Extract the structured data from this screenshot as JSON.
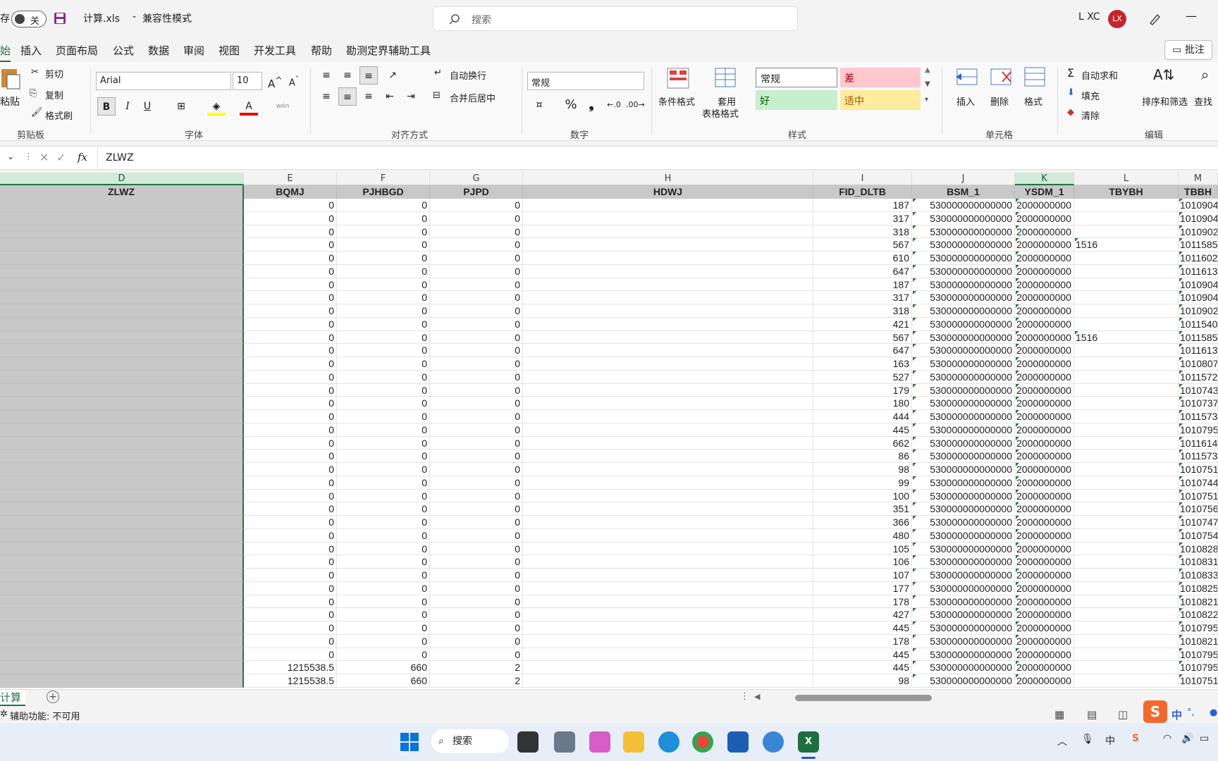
{
  "titlebar": {
    "autosave_label": "存",
    "autosave_state": "关",
    "filename": "计算.xls",
    "separator": "-",
    "mode": "兼容性模式",
    "search_placeholder": "搜索",
    "user_name": "L XC",
    "avatar_initials": "LX"
  },
  "menu": {
    "items": [
      "始",
      "插入",
      "页面布局",
      "公式",
      "数据",
      "审阅",
      "视图",
      "开发工具",
      "帮助",
      "勘测定界辅助工具"
    ],
    "comment_button": "批注"
  },
  "ribbon": {
    "clipboard": {
      "paste": "粘贴",
      "cut": "剪切",
      "copy": "复制",
      "format_painter": "格式刷",
      "group_label": "剪贴板"
    },
    "font": {
      "family": "Arial",
      "size": "10",
      "bold": "B",
      "italic": "I",
      "underline": "U",
      "wen": "wén",
      "group_label": "字体"
    },
    "alignment": {
      "wrap_text": "自动换行",
      "merge_center": "合并后居中",
      "group_label": "对齐方式"
    },
    "number": {
      "format": "常规",
      "percent": "%",
      "comma": "❟",
      "group_label": "数字"
    },
    "styles": {
      "conditional": "条件格式",
      "table_line1": "套用",
      "table_line2": "表格格式",
      "normal": "常规",
      "bad": "差",
      "good": "好",
      "neutral": "适中",
      "group_label": "样式"
    },
    "cells": {
      "insert": "插入",
      "delete": "删除",
      "format": "格式",
      "group_label": "单元格"
    },
    "editing": {
      "autosum": "自动求和",
      "fill": "填充",
      "clear": "清除",
      "sort_filter": "排序和筛选",
      "find": "查找",
      "group_label": "编辑"
    },
    "colors": {
      "bad_bg": "#ffc7ce",
      "bad_fg": "#9c0006",
      "good_bg": "#c6efce",
      "good_fg": "#006100",
      "neutral_bg": "#ffeb9c",
      "neutral_fg": "#9c5700"
    }
  },
  "formula_bar": {
    "content": "ZLWZ",
    "fx": "fx"
  },
  "grid": {
    "column_letters": [
      "D",
      "E",
      "F",
      "G",
      "H",
      "I",
      "J",
      "K",
      "L",
      "M"
    ],
    "headers": [
      "ZLWZ",
      "BQMJ",
      "PJHBGD",
      "PJPD",
      "HDWJ",
      "FID_DLTB",
      "BSM_1",
      "YSDM_1",
      "TBYBH",
      "TBBH"
    ],
    "rows": [
      [
        "",
        "0",
        "0",
        "0",
        "",
        "187",
        "530000000000000",
        "2000000000",
        "",
        "1010904"
      ],
      [
        "",
        "0",
        "0",
        "0",
        "",
        "317",
        "530000000000000",
        "2000000000",
        "",
        "1010904"
      ],
      [
        "",
        "0",
        "0",
        "0",
        "",
        "318",
        "530000000000000",
        "2000000000",
        "",
        "1010902"
      ],
      [
        "",
        "0",
        "0",
        "0",
        "",
        "567",
        "530000000000000",
        "2000000000",
        "1516",
        "1011585"
      ],
      [
        "",
        "0",
        "0",
        "0",
        "",
        "610",
        "530000000000000",
        "2000000000",
        "",
        "1011602"
      ],
      [
        "",
        "0",
        "0",
        "0",
        "",
        "647",
        "530000000000000",
        "2000000000",
        "",
        "1011613"
      ],
      [
        "",
        "0",
        "0",
        "0",
        "",
        "187",
        "530000000000000",
        "2000000000",
        "",
        "1010904"
      ],
      [
        "",
        "0",
        "0",
        "0",
        "",
        "317",
        "530000000000000",
        "2000000000",
        "",
        "1010904"
      ],
      [
        "",
        "0",
        "0",
        "0",
        "",
        "318",
        "530000000000000",
        "2000000000",
        "",
        "1010902"
      ],
      [
        "",
        "0",
        "0",
        "0",
        "",
        "421",
        "530000000000000",
        "2000000000",
        "",
        "1011540"
      ],
      [
        "",
        "0",
        "0",
        "0",
        "",
        "567",
        "530000000000000",
        "2000000000",
        "1516",
        "1011585"
      ],
      [
        "",
        "0",
        "0",
        "0",
        "",
        "647",
        "530000000000000",
        "2000000000",
        "",
        "1011613"
      ],
      [
        "",
        "0",
        "0",
        "0",
        "",
        "163",
        "530000000000000",
        "2000000000",
        "",
        "1010807"
      ],
      [
        "",
        "0",
        "0",
        "0",
        "",
        "527",
        "530000000000000",
        "2000000000",
        "",
        "1011572"
      ],
      [
        "",
        "0",
        "0",
        "0",
        "",
        "179",
        "530000000000000",
        "2000000000",
        "",
        "1010743"
      ],
      [
        "",
        "0",
        "0",
        "0",
        "",
        "180",
        "530000000000000",
        "2000000000",
        "",
        "1010737"
      ],
      [
        "",
        "0",
        "0",
        "0",
        "",
        "444",
        "530000000000000",
        "2000000000",
        "",
        "1011573"
      ],
      [
        "",
        "0",
        "0",
        "0",
        "",
        "445",
        "530000000000000",
        "2000000000",
        "",
        "1010795"
      ],
      [
        "",
        "0",
        "0",
        "0",
        "",
        "662",
        "530000000000000",
        "2000000000",
        "",
        "1011614"
      ],
      [
        "",
        "0",
        "0",
        "0",
        "",
        "86",
        "530000000000000",
        "2000000000",
        "",
        "1011573"
      ],
      [
        "",
        "0",
        "0",
        "0",
        "",
        "98",
        "530000000000000",
        "2000000000",
        "",
        "1010751"
      ],
      [
        "",
        "0",
        "0",
        "0",
        "",
        "99",
        "530000000000000",
        "2000000000",
        "",
        "1010744"
      ],
      [
        "",
        "0",
        "0",
        "0",
        "",
        "100",
        "530000000000000",
        "2000000000",
        "",
        "1010751"
      ],
      [
        "",
        "0",
        "0",
        "0",
        "",
        "351",
        "530000000000000",
        "2000000000",
        "",
        "1010756"
      ],
      [
        "",
        "0",
        "0",
        "0",
        "",
        "366",
        "530000000000000",
        "2000000000",
        "",
        "1010747"
      ],
      [
        "",
        "0",
        "0",
        "0",
        "",
        "480",
        "530000000000000",
        "2000000000",
        "",
        "1010754"
      ],
      [
        "",
        "0",
        "0",
        "0",
        "",
        "105",
        "530000000000000",
        "2000000000",
        "",
        "1010828"
      ],
      [
        "",
        "0",
        "0",
        "0",
        "",
        "106",
        "530000000000000",
        "2000000000",
        "",
        "1010831"
      ],
      [
        "",
        "0",
        "0",
        "0",
        "",
        "107",
        "530000000000000",
        "2000000000",
        "",
        "1010833"
      ],
      [
        "",
        "0",
        "0",
        "0",
        "",
        "177",
        "530000000000000",
        "2000000000",
        "",
        "1010825"
      ],
      [
        "",
        "0",
        "0",
        "0",
        "",
        "178",
        "530000000000000",
        "2000000000",
        "",
        "1010821"
      ],
      [
        "",
        "0",
        "0",
        "0",
        "",
        "427",
        "530000000000000",
        "2000000000",
        "",
        "1010822"
      ],
      [
        "",
        "0",
        "0",
        "0",
        "",
        "445",
        "530000000000000",
        "2000000000",
        "",
        "1010795"
      ],
      [
        "",
        "0",
        "0",
        "0",
        "",
        "178",
        "530000000000000",
        "2000000000",
        "",
        "1010821"
      ],
      [
        "",
        "0",
        "0",
        "0",
        "",
        "445",
        "530000000000000",
        "2000000000",
        "",
        "1010795"
      ],
      [
        "",
        "1215538.5",
        "660",
        "2",
        "",
        "445",
        "530000000000000",
        "2000000000",
        "",
        "1010795"
      ],
      [
        "",
        "1215538.5",
        "660",
        "2",
        "",
        "98",
        "530000000000000",
        "2000000000",
        "",
        "1010751"
      ]
    ]
  },
  "sheetbar": {
    "tab": "计算",
    "add": "+"
  },
  "status": {
    "accessibility": "辅助功能: 不可用"
  },
  "taskbar": {
    "search": "搜索",
    "ime": "中"
  }
}
